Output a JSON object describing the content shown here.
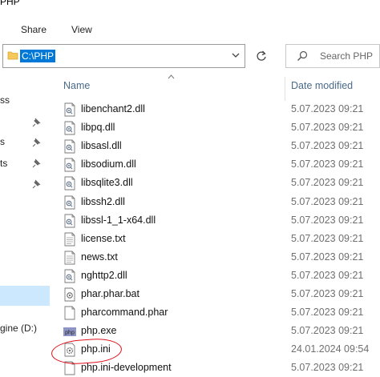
{
  "window": {
    "title": "PHP"
  },
  "ribbon": {
    "tabs": [
      "Share",
      "View"
    ]
  },
  "address": {
    "path": "C:\\PHP"
  },
  "search": {
    "placeholder": "Search PHP"
  },
  "nav": {
    "items": [
      {
        "label": "ss",
        "pinned": false
      },
      {
        "label": "",
        "pinned": true
      },
      {
        "label": "s",
        "pinned": true
      },
      {
        "label": "ts",
        "pinned": true
      },
      {
        "label": "",
        "pinned": true
      },
      {
        "label": "gine (D:)",
        "pinned": false
      }
    ]
  },
  "columns": {
    "name": "Name",
    "date_modified": "Date modified"
  },
  "files": [
    {
      "name": "libenchant2.dll",
      "date": "5.07.2023 09:21",
      "icon": "dll-file-icon"
    },
    {
      "name": "libpq.dll",
      "date": "5.07.2023 09:21",
      "icon": "dll-file-icon"
    },
    {
      "name": "libsasl.dll",
      "date": "5.07.2023 09:21",
      "icon": "dll-file-icon"
    },
    {
      "name": "libsodium.dll",
      "date": "5.07.2023 09:21",
      "icon": "dll-file-icon"
    },
    {
      "name": "libsqlite3.dll",
      "date": "5.07.2023 09:21",
      "icon": "dll-file-icon"
    },
    {
      "name": "libssh2.dll",
      "date": "5.07.2023 09:21",
      "icon": "dll-file-icon"
    },
    {
      "name": "libssl-1_1-x64.dll",
      "date": "5.07.2023 09:21",
      "icon": "dll-file-icon"
    },
    {
      "name": "license.txt",
      "date": "5.07.2023 09:21",
      "icon": "text-file-icon"
    },
    {
      "name": "news.txt",
      "date": "5.07.2023 09:21",
      "icon": "text-file-icon"
    },
    {
      "name": "nghttp2.dll",
      "date": "5.07.2023 09:21",
      "icon": "dll-file-icon"
    },
    {
      "name": "phar.phar.bat",
      "date": "5.07.2023 09:21",
      "icon": "batch-file-icon"
    },
    {
      "name": "pharcommand.phar",
      "date": "5.07.2023 09:21",
      "icon": "blank-file-icon"
    },
    {
      "name": "php.exe",
      "date": "5.07.2023 09:21",
      "icon": "php-exe-icon"
    },
    {
      "name": "php.ini",
      "date": "24.01.2024 09:54",
      "icon": "settings-file-icon"
    },
    {
      "name": "php.ini-development",
      "date": "5.07.2023 09:21",
      "icon": "blank-file-icon"
    }
  ],
  "colors": {
    "selection": "#0078d7",
    "nav_selected": "#cce8ff",
    "annotation": "#e0101a",
    "header_text": "#4a6a8a"
  }
}
